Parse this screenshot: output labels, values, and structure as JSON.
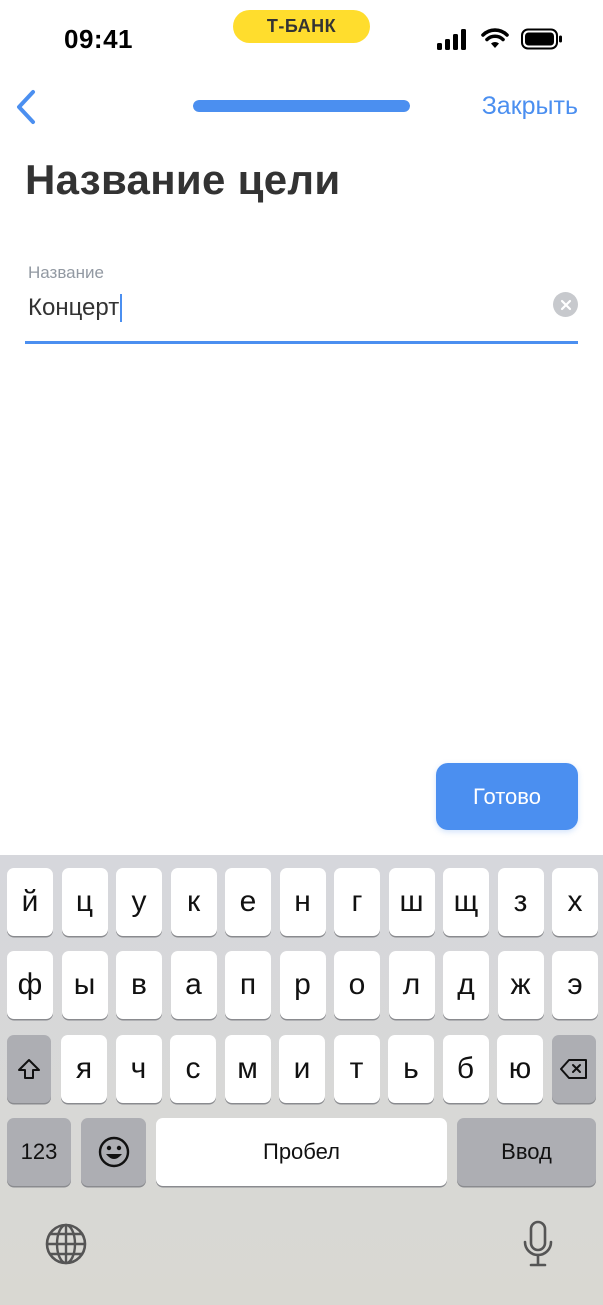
{
  "status_bar": {
    "time": "09:41",
    "brand": "Т‑БАНК",
    "icons": [
      "cellular-signal-icon",
      "wifi-icon",
      "battery-icon"
    ]
  },
  "nav": {
    "back_icon": "chevron-left-icon",
    "progress_fraction": 1.0,
    "close_label": "Закрыть"
  },
  "page": {
    "title": "Название цели"
  },
  "field": {
    "label": "Название",
    "value": "Концерт",
    "clear_icon": "clear-circle-icon"
  },
  "done_button": {
    "label": "Готово"
  },
  "keyboard": {
    "row1": [
      "й",
      "ц",
      "у",
      "к",
      "е",
      "н",
      "г",
      "ш",
      "щ",
      "з",
      "х"
    ],
    "row2": [
      "ф",
      "ы",
      "в",
      "а",
      "п",
      "р",
      "о",
      "л",
      "д",
      "ж",
      "э"
    ],
    "row3": [
      "я",
      "ч",
      "с",
      "м",
      "и",
      "т",
      "ь",
      "б",
      "ю"
    ],
    "shift_icon": "shift-icon",
    "delete_icon": "backspace-icon",
    "numbers_label": "123",
    "emoji_icon": "emoji-icon",
    "space_label": "Пробел",
    "return_label": "Ввод",
    "globe_icon": "globe-icon",
    "mic_icon": "microphone-icon"
  },
  "colors": {
    "accent": "#4B8FF0",
    "brand_yellow": "#FFDD2D",
    "title_text": "#333333",
    "keyboard_bg": "#D6D7DC"
  }
}
